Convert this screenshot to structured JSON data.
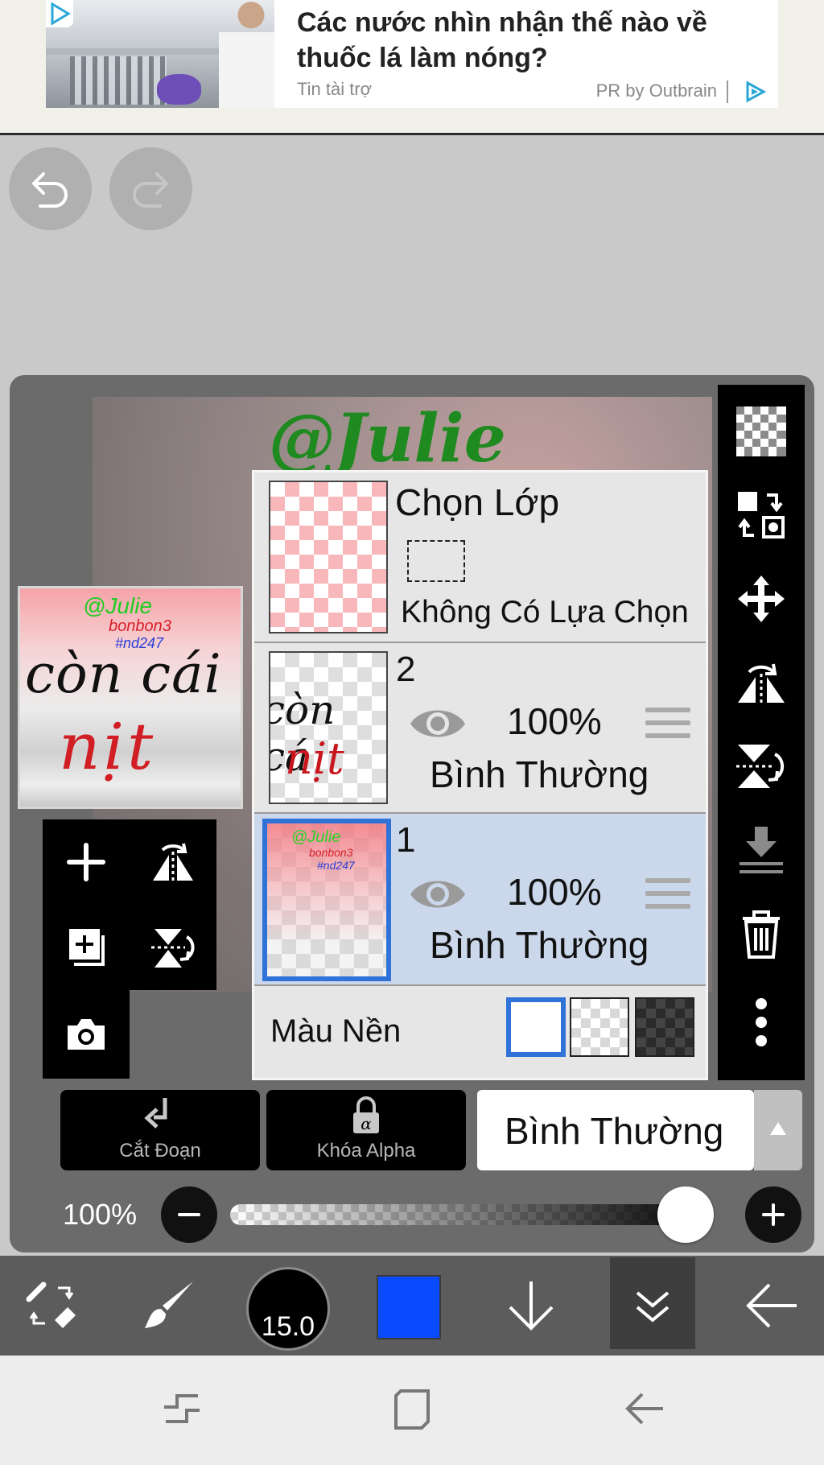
{
  "ad": {
    "headline": "Các nước nhìn nhận thế nào về thuốc lá làm nóng?",
    "sponsor": "Tin tài trợ",
    "provider": "PR by Outbrain"
  },
  "artwork": {
    "signature": "@Julie",
    "preview_sign": "@Julie",
    "preview_mid1": "bonbon3",
    "preview_mid2": "#nd247",
    "preview_line1": "còn cái",
    "preview_line2": "nịt"
  },
  "layers": {
    "selection": {
      "title": "Chọn Lớp",
      "status": "Không Có Lựa Chọn"
    },
    "items": [
      {
        "number": "2",
        "opacity": "100%",
        "blend": "Bình Thường",
        "thumb_line1": "còn cá",
        "thumb_line2": "nịt",
        "selected": false
      },
      {
        "number": "1",
        "opacity": "100%",
        "blend": "Bình Thường",
        "thumb_sign": "@Julie",
        "thumb_mid1": "bonbon3",
        "thumb_mid2": "#nd247",
        "selected": true
      }
    ],
    "background": {
      "label": "Màu Nền",
      "options": [
        "white",
        "transparent",
        "dark-checker"
      ],
      "selected": "white"
    }
  },
  "controls": {
    "clipping_label": "Cắt Đoạn",
    "alpha_lock_label": "Khóa Alpha",
    "blend_mode": "Bình Thường",
    "opacity_label": "100%",
    "opacity_value": 1.0
  },
  "bottom_toolbar": {
    "brush_size": "15.0",
    "current_color": "#0a4bff"
  },
  "colors": {
    "selection_blue": "#2f73d8",
    "selected_row": "#cbd7ea",
    "toolbar_black": "#000000"
  }
}
